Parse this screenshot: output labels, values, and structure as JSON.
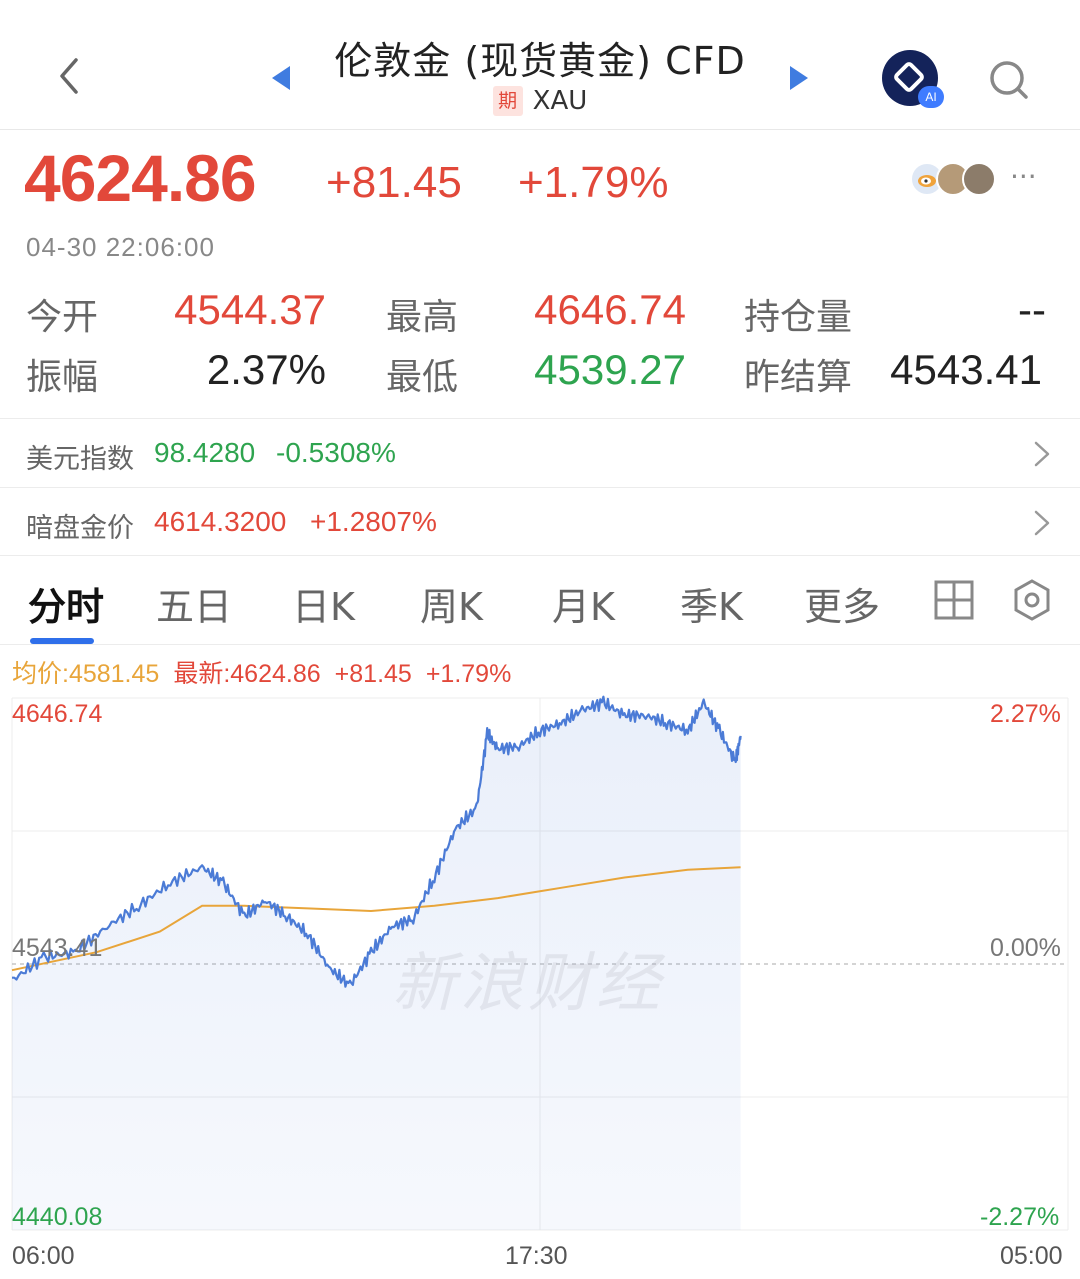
{
  "header": {
    "title": "伦敦金 (现货黄金) CFD",
    "badge": "期",
    "symbol": "XAU",
    "ai_badge": "AI"
  },
  "quote": {
    "price": "4624.86",
    "change": "+81.45",
    "change_pct": "+1.79%",
    "timestamp": "04-30 22:06:00",
    "more": "···"
  },
  "stats": [
    {
      "label": "今开",
      "value": "4544.37",
      "color": "red"
    },
    {
      "label": "最高",
      "value": "4646.74",
      "color": "red"
    },
    {
      "label": "持仓量",
      "value": "--",
      "color": "dark"
    },
    {
      "label": "振幅",
      "value": "2.37%",
      "color": "dark"
    },
    {
      "label": "最低",
      "value": "4539.27",
      "color": "green"
    },
    {
      "label": "昨结算",
      "value": "4543.41",
      "color": "dark"
    }
  ],
  "indices": [
    {
      "label": "美元指数",
      "value": "98.4280",
      "pct": "-0.5308%",
      "color": "#2ea44f"
    },
    {
      "label": "暗盘金价",
      "value": "4614.3200",
      "pct": "+1.2807%",
      "color": "#e2483a"
    }
  ],
  "tabs": [
    "分时",
    "五日",
    "日K",
    "周K",
    "月K",
    "季K",
    "更多"
  ],
  "legend": {
    "avg": "均价:4581.45",
    "latest": "最新:4624.86",
    "change": "+81.45",
    "change_pct": "+1.79%"
  },
  "chart_axis": {
    "y_top": "4646.74",
    "y_mid": "4543.41",
    "y_bottom": "4440.08",
    "pct_top": "2.27%",
    "pct_mid": "0.00%",
    "pct_bottom": "-2.27%",
    "x_start": "06:00",
    "x_mid": "17:30",
    "x_end": "05:00"
  },
  "watermark": "新浪财经",
  "colors": {
    "up": "#e2483a",
    "down": "#2ea44f",
    "price_line": "#4b7bd6",
    "avg_line": "#e8a53a",
    "tab_accent": "#2f6fea"
  },
  "chart_data": {
    "type": "line",
    "x_range": [
      "06:00",
      "05:00"
    ],
    "ylim": [
      4440.08,
      4646.74
    ],
    "base": 4543.41,
    "series": [
      {
        "name": "最新",
        "x": [
          0,
          0.03,
          0.06,
          0.09,
          0.12,
          0.15,
          0.18,
          0.2,
          0.22,
          0.24,
          0.26,
          0.28,
          0.3,
          0.32,
          0.34,
          0.36,
          0.38,
          0.4,
          0.42,
          0.44,
          0.45,
          0.46,
          0.48,
          0.5,
          0.52,
          0.54,
          0.56,
          0.58,
          0.6,
          0.62,
          0.64,
          0.655,
          0.67,
          0.685,
          0.69
        ],
        "values": [
          4537,
          4546,
          4548,
          4558,
          4566,
          4575,
          4581,
          4575,
          4562,
          4568,
          4562,
          4555,
          4542,
          4535,
          4548,
          4558,
          4561,
          4577,
          4596,
          4604,
          4633,
          4627,
          4628,
          4634,
          4637,
          4642,
          4645,
          4640,
          4640,
          4637,
          4634,
          4645,
          4634,
          4622,
          4632
        ]
      },
      {
        "name": "均价",
        "x": [
          0,
          0.08,
          0.14,
          0.18,
          0.22,
          0.28,
          0.34,
          0.4,
          0.46,
          0.52,
          0.58,
          0.64,
          0.69
        ],
        "values": [
          4541,
          4548,
          4556,
          4566,
          4566,
          4565,
          4564,
          4566,
          4569,
          4573,
          4577,
          4580,
          4581
        ]
      }
    ]
  }
}
